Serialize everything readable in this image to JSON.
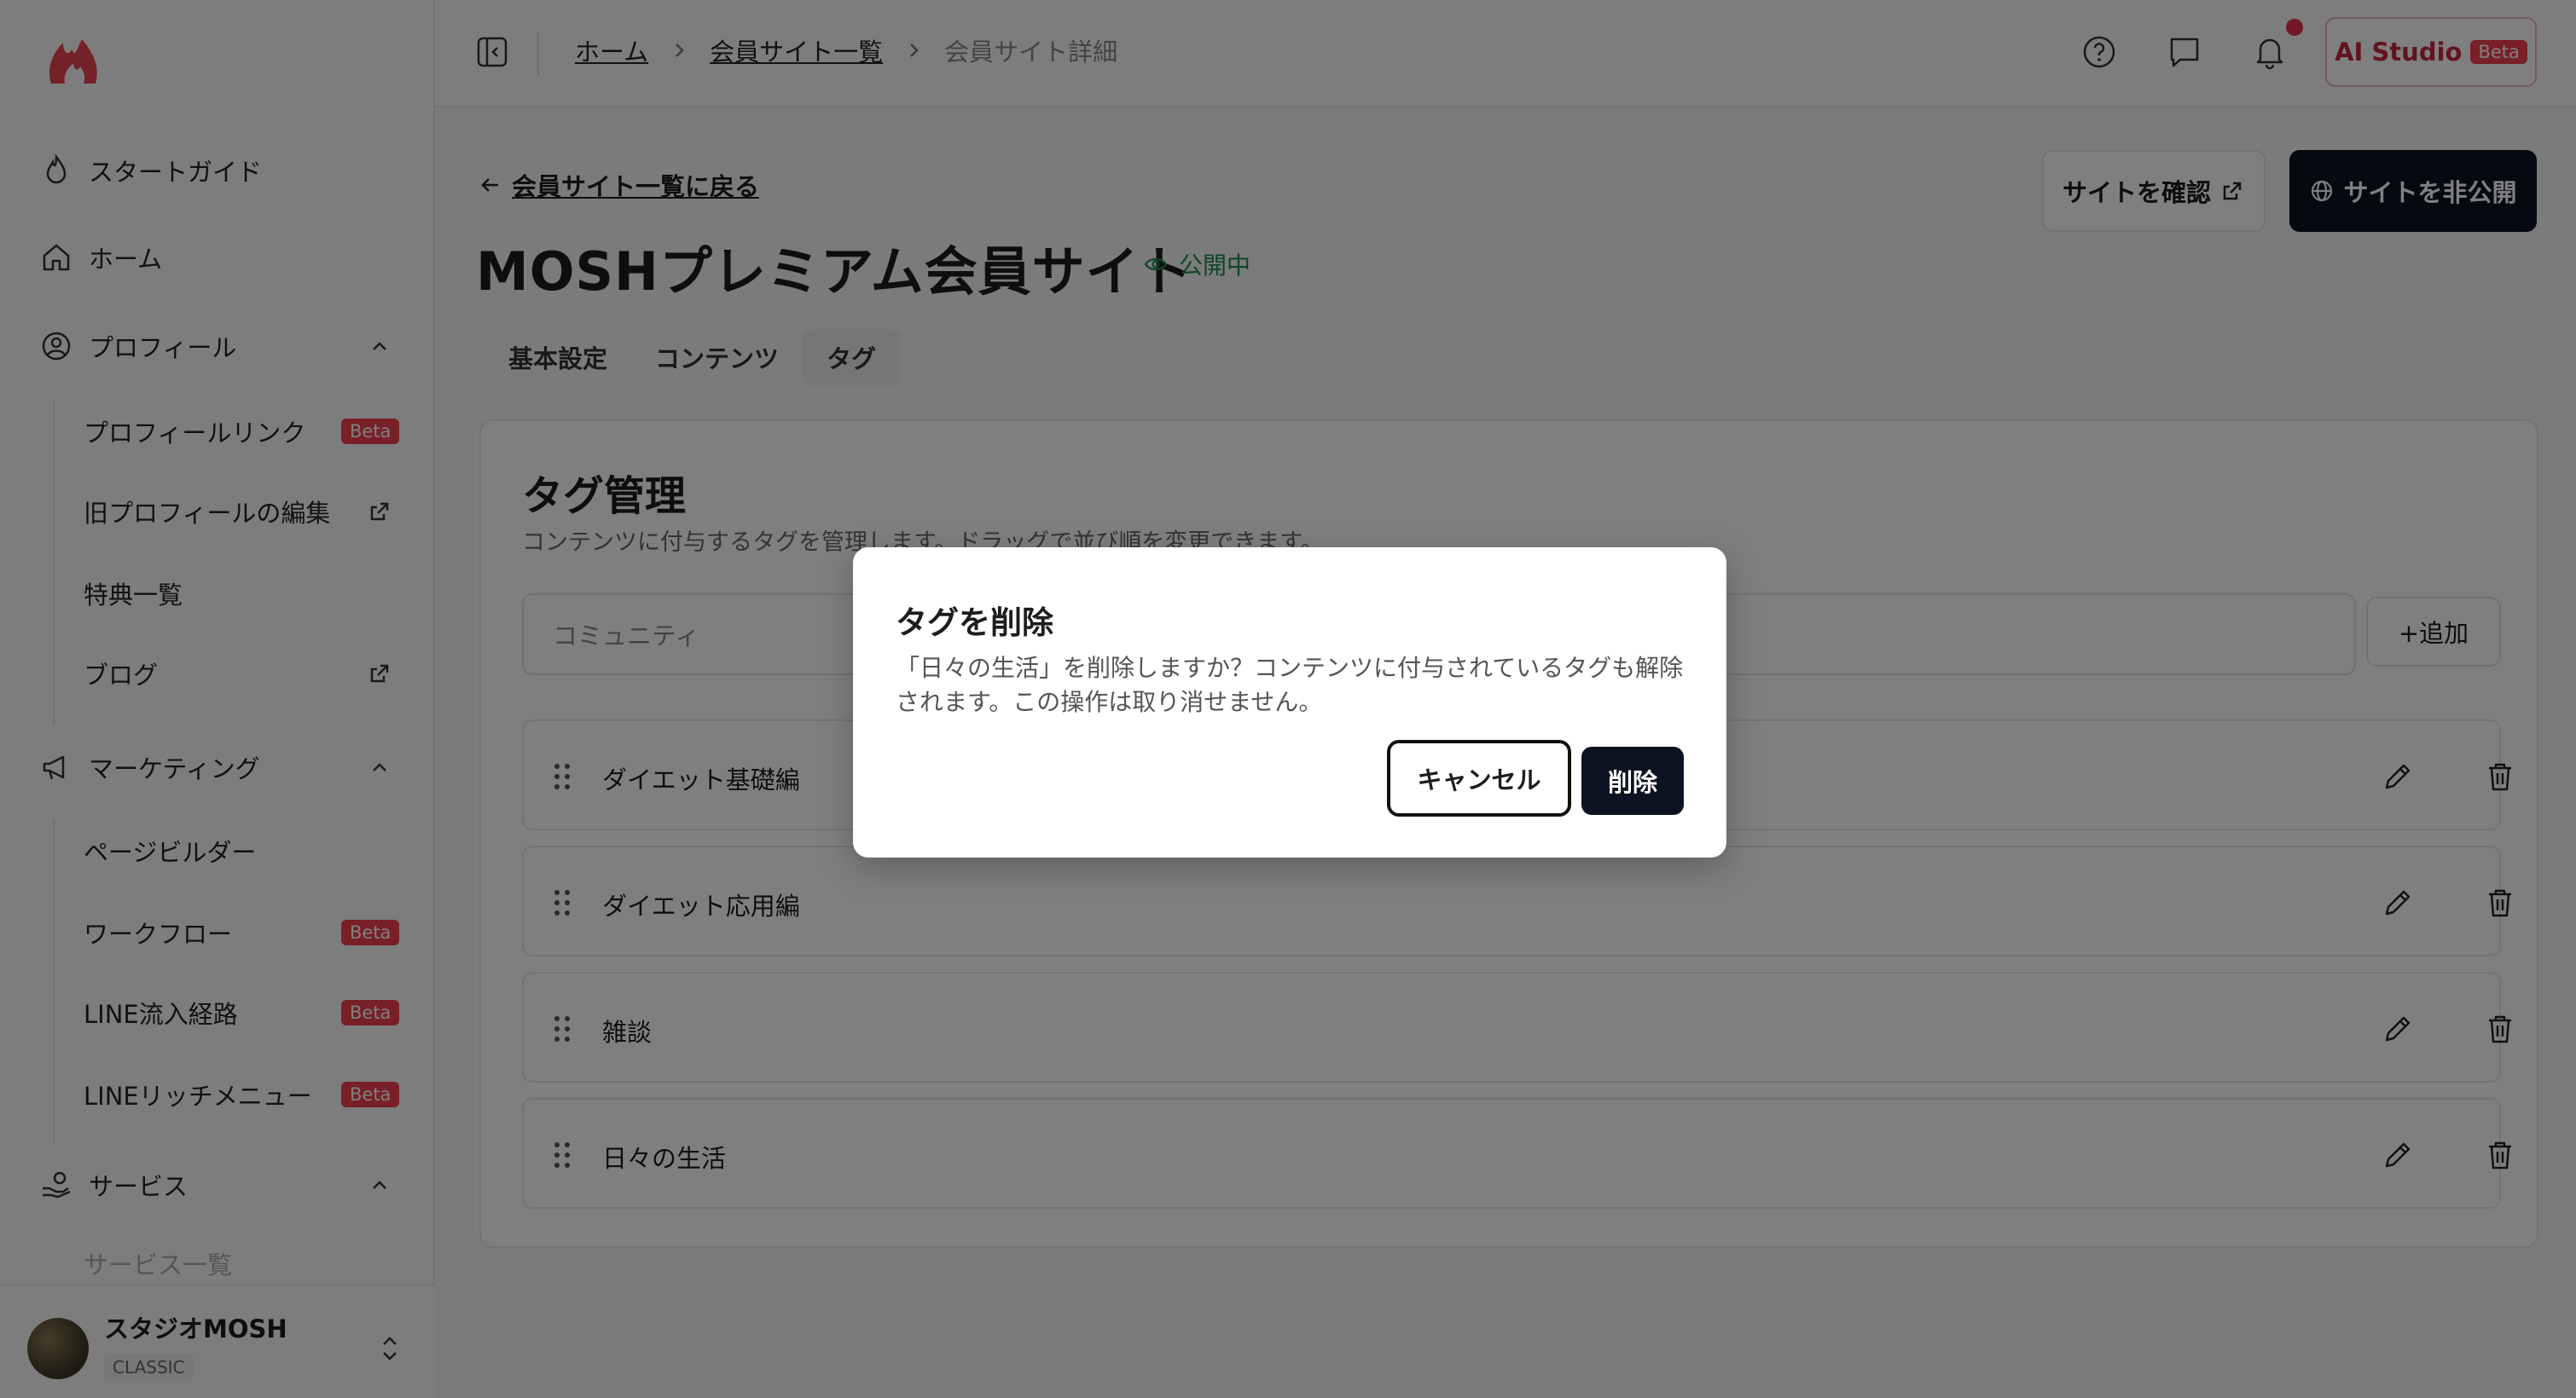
{
  "sidebar": {
    "items": [
      {
        "label": "スタートガイド"
      },
      {
        "label": "ホーム"
      },
      {
        "label": "プロフィール"
      },
      {
        "label": "マーケティング"
      },
      {
        "label": "サービス"
      }
    ],
    "profile_sub": [
      {
        "label": "プロフィールリンク",
        "badge": "Beta"
      },
      {
        "label": "旧プロフィールの編集"
      },
      {
        "label": "特典一覧"
      },
      {
        "label": "ブログ"
      }
    ],
    "marketing_sub": [
      {
        "label": "ページビルダー"
      },
      {
        "label": "ワークフロー",
        "badge": "Beta"
      },
      {
        "label": "LINE流入経路",
        "badge": "Beta"
      },
      {
        "label": "LINEリッチメニュー",
        "badge": "Beta"
      }
    ],
    "service_sub": [
      {
        "label": "サービス一覧"
      }
    ],
    "account": {
      "name": "スタジオMOSH",
      "plan": "CLASSIC"
    }
  },
  "header": {
    "breadcrumb": [
      "ホーム",
      "会員サイト一覧",
      "会員サイト詳細"
    ],
    "ai_label": "AI Studio",
    "ai_badge": "Beta"
  },
  "page": {
    "back_label": "会員サイト一覧に戻る",
    "title": "MOSHプレミアム会員サイト",
    "status": "公開中",
    "view_site": "サイトを確認",
    "unpublish": "サイトを非公開",
    "tabs": [
      "基本設定",
      "コンテンツ",
      "タグ"
    ]
  },
  "tags": {
    "heading": "タグ管理",
    "description": "コンテンツに付与するタグを管理します。ドラッグで並び順を変更できます。",
    "input_value": "コミュニティ",
    "add_label": "+追加",
    "rows": [
      "ダイエット基礎編",
      "ダイエット応用編",
      "雑談",
      "日々の生活"
    ]
  },
  "modal": {
    "title": "タグを削除",
    "message": "「日々の生活」を削除しますか？コンテンツに付与されているタグも解除されます。この操作は取り消せません。",
    "cancel": "キャンセル",
    "delete": "削除"
  },
  "colors": {
    "accent": "#f03e4e",
    "primary": "#0b1220",
    "status_green": "#1c8a4a"
  }
}
